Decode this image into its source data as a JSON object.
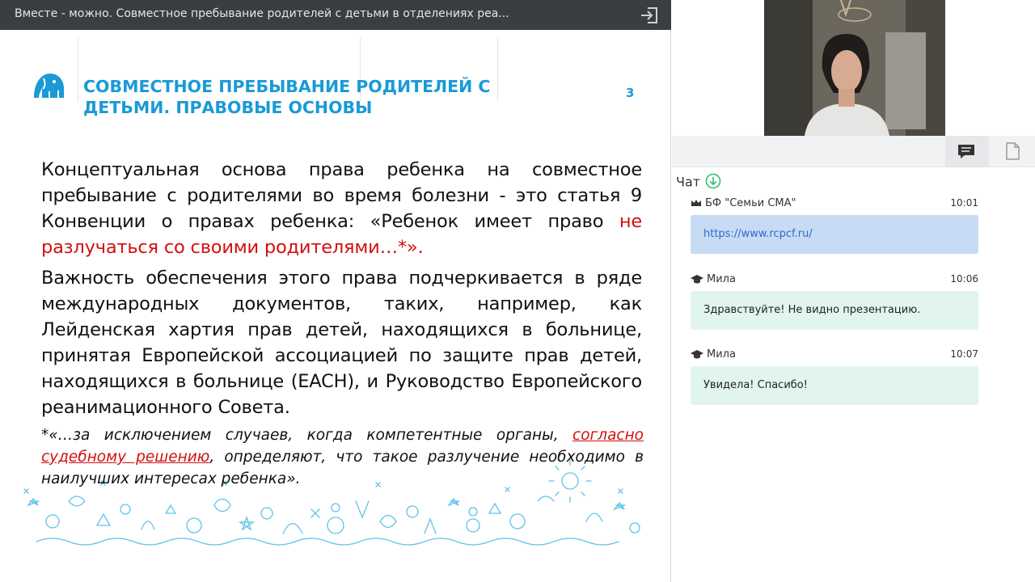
{
  "window": {
    "title": "Вместе - можно. Совместное пребывание родителей с детьми в отделениях реа...",
    "exit_icon": "logout-icon"
  },
  "slide": {
    "title_line1": "СОВМЕСТНОЕ ПРЕБЫВАНИЕ РОДИТЕЛЕЙ С",
    "title_line2": "ДЕТЬМИ. ПРАВОВЫЕ ОСНОВЫ",
    "page_number": "3",
    "paragraph1_black": "Концептуальная основа права ребенка на совместное пребывание с родителями во время болезни - это статья 9 Конвенции о правах ребенка: «Ребенок имеет право ",
    "paragraph1_red": "не разлучаться со своими родителями…*».",
    "paragraph2": "Важность обеспечения этого права подчеркивается в ряде международных документов, таких, например, как Лейденская хартия прав детей, находящихся в больнице, принятая Европейской ассоциацией по защите прав детей, находящихся в больнице (EACH), и Руководство Европейского реанимационного Совета.",
    "note_black1": "*«…за исключением случаев, когда компетентные органы, ",
    "note_red": "согласно судебному решению",
    "note_black2": ", определяют, что такое разлучение необходимо в наилучших интересах ребенка».",
    "colors": {
      "title": "#1a9ad6",
      "highlight": "#d21010"
    }
  },
  "panel": {
    "chat_tab_icon": "chat-icon",
    "files_tab_icon": "document-icon",
    "chat_title": "Чат",
    "messages": [
      {
        "author": "БФ \"Семьи СМА\"",
        "time": "10:01",
        "text": "https://www.rcpcf.ru/",
        "role_icon": "crown-icon"
      },
      {
        "author": "Мила",
        "time": "10:06",
        "text": "Здравствуйте! Не видно презентацию.",
        "role_icon": "graduation-cap-icon"
      },
      {
        "author": "Мила",
        "time": "10:07",
        "text": "Увидела! Спасибо!",
        "role_icon": "graduation-cap-icon"
      }
    ]
  }
}
